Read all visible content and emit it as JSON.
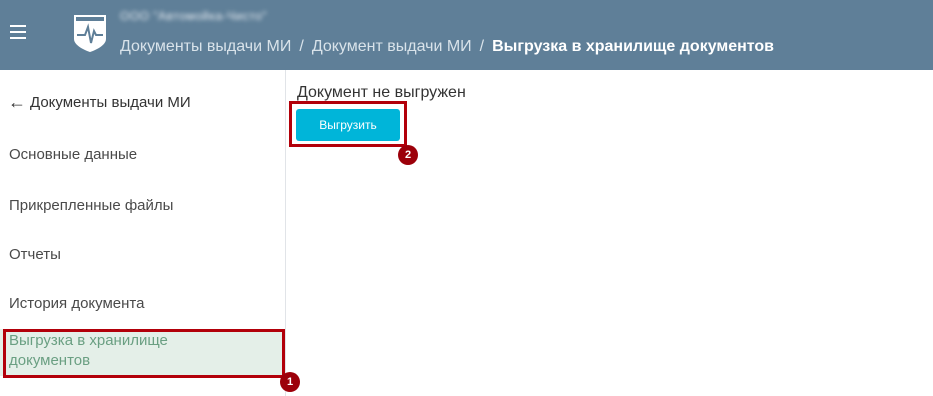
{
  "header": {
    "org_name": "ООО \"Автомойка-Чисто\"",
    "breadcrumb": {
      "item1": "Документы выдачи МИ",
      "item2": "Документ выдачи МИ",
      "current": "Выгрузка в хранилище документов",
      "separator": "/"
    }
  },
  "sidebar": {
    "back_label": "Документы выдачи МИ",
    "items": [
      {
        "label": "Основные данные"
      },
      {
        "label": "Прикрепленные файлы"
      },
      {
        "label": "Отчеты"
      },
      {
        "label": "История документа"
      },
      {
        "label": "Выгрузка в хранилище документов"
      }
    ]
  },
  "main": {
    "status_text": "Документ не выгружен",
    "upload_label": "Выгрузить"
  },
  "annotations": {
    "badge1": "1",
    "badge2": "2"
  },
  "colors": {
    "header_bg": "#5f7f98",
    "active_item_bg": "#e4efe8",
    "active_item_text": "#6a9f82",
    "button_bg": "#00b5d9",
    "annotation_red": "#b2000a"
  }
}
